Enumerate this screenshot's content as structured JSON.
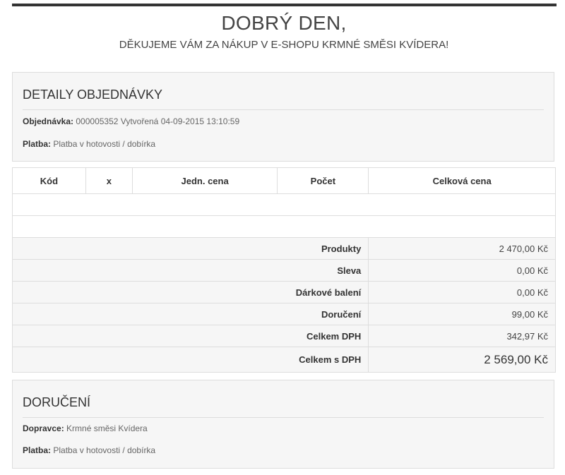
{
  "header": {
    "greeting": "DOBRÝ DEN,",
    "thanks": "DĚKUJEME VÁM ZA NÁKUP V E-SHOPU KRMNÉ SMĚSI KVÍDERA!"
  },
  "order_details": {
    "title": "DETAILY OBJEDNÁVKY",
    "order_label": "Objednávka:",
    "order_value": "000005352 Vytvořená 04-09-2015 13:10:59",
    "payment_label": "Platba:",
    "payment_value": "Platba v hotovosti / dobírka"
  },
  "table": {
    "headers": [
      "Kód",
      "x",
      "Jedn. cena",
      "Počet",
      "Celková cena"
    ],
    "summary": [
      {
        "label": "Produkty",
        "value": "2 470,00 Kč"
      },
      {
        "label": "Sleva",
        "value": "0,00 Kč"
      },
      {
        "label": "Dárkové balení",
        "value": "0,00 Kč"
      },
      {
        "label": "Doručení",
        "value": "99,00 Kč"
      },
      {
        "label": "Celkem DPH",
        "value": "342,97 Kč"
      },
      {
        "label": "Celkem s DPH",
        "value": "2 569,00 Kč"
      }
    ]
  },
  "delivery": {
    "title": "DORUČENÍ",
    "carrier_label": "Dopravce:",
    "carrier_value": "Krmné směsi Kvídera",
    "payment_label": "Platba:",
    "payment_value": "Platba v hotovosti / dobírka"
  },
  "colors": {
    "topbar": "#333333",
    "box_bg": "#f6f6f6",
    "border": "#dddddd"
  }
}
